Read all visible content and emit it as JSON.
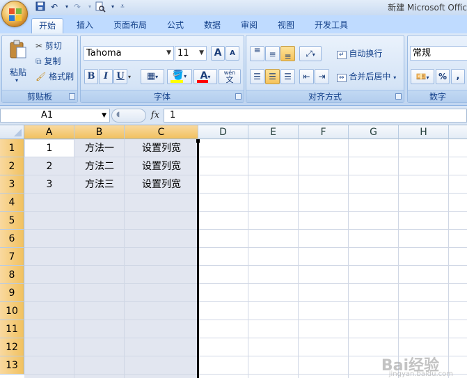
{
  "titlebar": {
    "title": "新建 Microsoft Offic"
  },
  "tabs": [
    {
      "label": "开始",
      "active": true
    },
    {
      "label": "插入"
    },
    {
      "label": "页面布局"
    },
    {
      "label": "公式"
    },
    {
      "label": "数据"
    },
    {
      "label": "审阅"
    },
    {
      "label": "视图"
    },
    {
      "label": "开发工具"
    }
  ],
  "clipboard": {
    "paste_label": "粘贴",
    "cut_label": "剪切",
    "copy_label": "复制",
    "format_painter_label": "格式刷",
    "group_label": "剪贴板"
  },
  "font": {
    "family": "Tahoma",
    "size": "11",
    "bold": "B",
    "italic": "I",
    "underline": "U",
    "wen": "wén",
    "wen_char": "文",
    "color_glyph": "A",
    "grow_glyph": "A",
    "shrink_glyph": "A",
    "group_label": "字体",
    "font_color": "#ff0000",
    "fill_color": "#ffff00"
  },
  "alignment": {
    "wrap_label": "自动换行",
    "merge_label": "合并后居中",
    "group_label": "对齐方式"
  },
  "number": {
    "format": "常规",
    "percent": "%",
    "comma": ",",
    "group_label": "数字"
  },
  "formula_bar": {
    "name_box": "A1",
    "fx": "fx",
    "formula": "1"
  },
  "sheet": {
    "columns": [
      "A",
      "B",
      "C",
      "D",
      "E",
      "F",
      "G",
      "H"
    ],
    "rows": [
      "1",
      "2",
      "3",
      "4",
      "5",
      "6",
      "7",
      "8",
      "9",
      "10",
      "11",
      "12",
      "13"
    ],
    "cells": [
      [
        "1",
        "方法一",
        "设置列宽"
      ],
      [
        "2",
        "方法二",
        "设置列宽"
      ],
      [
        "3",
        "方法三",
        "设置列宽"
      ]
    ],
    "selection_color": "#e2e6f0"
  },
  "watermark": {
    "text": "Bai经验",
    "sub": "jingyan.baidu.com"
  }
}
